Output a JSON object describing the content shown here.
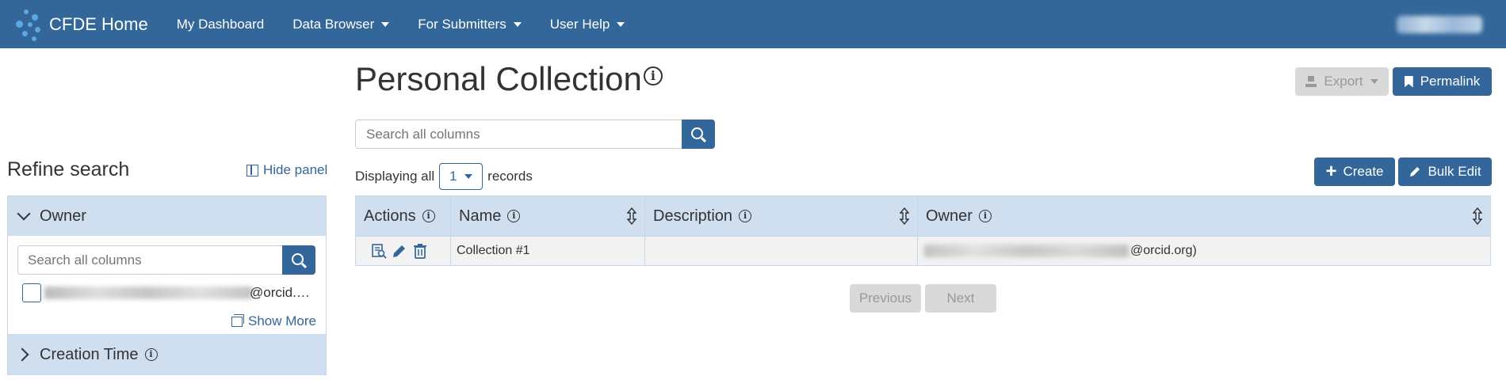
{
  "navbar": {
    "brand": "CFDE Home",
    "items": [
      {
        "label": "My Dashboard",
        "dropdown": false
      },
      {
        "label": "Data Browser",
        "dropdown": true
      },
      {
        "label": "For Submitters",
        "dropdown": true
      },
      {
        "label": "User Help",
        "dropdown": true
      }
    ],
    "icons": {
      "logo": "cfde-logo-icon",
      "caret": "caret-down-icon"
    }
  },
  "sidebar": {
    "title": "Refine search",
    "hide_panel": "Hide panel",
    "facets": [
      {
        "label": "Owner",
        "expanded": true,
        "search_placeholder": "Search all columns",
        "options": [
          {
            "label_suffix": "@orcid.…",
            "checked": false
          }
        ],
        "show_more": "Show More"
      },
      {
        "label": "Creation Time",
        "expanded": false
      }
    ]
  },
  "main": {
    "title": "Personal Collection",
    "export": "Export",
    "permalink": "Permalink",
    "search_placeholder": "Search all columns",
    "displaying_prefix": "Displaying all",
    "record_count": "1",
    "displaying_suffix": "records",
    "create": "Create",
    "bulk_edit": "Bulk Edit",
    "table": {
      "columns": [
        "Actions",
        "Name",
        "Description",
        "Owner"
      ],
      "rows": [
        {
          "name": "Collection #1",
          "description": "",
          "owner_suffix": "@orcid.org)"
        }
      ]
    },
    "pagination": {
      "previous": "Previous",
      "next": "Next"
    }
  },
  "colors": {
    "brand": "#336699",
    "header_bg": "#cfdff0",
    "disabled": "#d9d9d9"
  }
}
